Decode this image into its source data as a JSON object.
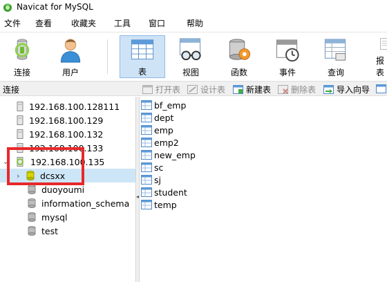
{
  "window": {
    "title": "Navicat for MySQL"
  },
  "menu": [
    "文件",
    "查看",
    "收藏夹",
    "工具",
    "窗口",
    "帮助"
  ],
  "toolbar": {
    "buttons": [
      {
        "label": "连接",
        "icon": "plug-connection-icon"
      },
      {
        "label": "用户",
        "icon": "user-icon"
      },
      {
        "label": "表",
        "icon": "table-icon",
        "active": true
      },
      {
        "label": "视图",
        "icon": "view-glasses-icon"
      },
      {
        "label": "函数",
        "icon": "function-gear-icon"
      },
      {
        "label": "事件",
        "icon": "event-clock-icon"
      },
      {
        "label": "查询",
        "icon": "query-table-icon"
      },
      {
        "label": "报表",
        "icon": "report-icon"
      }
    ]
  },
  "subbar": {
    "connection_label": "连接",
    "actions": [
      {
        "label": "打开表",
        "enabled": false
      },
      {
        "label": "设计表",
        "enabled": false
      },
      {
        "label": "新建表",
        "enabled": true
      },
      {
        "label": "删除表",
        "enabled": false
      },
      {
        "label": "导入向导",
        "enabled": true
      }
    ]
  },
  "connections": [
    {
      "label": "192.168.100.128111"
    },
    {
      "label": "192.168.100.129"
    },
    {
      "label": "192.168.100.132"
    },
    {
      "label": "192.168.100.133"
    },
    {
      "label": "192.168.100.135",
      "expanded": true
    }
  ],
  "databases": [
    {
      "label": "dcsxx",
      "selected": true
    },
    {
      "label": "duoyoumi"
    },
    {
      "label": "information_schema"
    },
    {
      "label": "mysql"
    },
    {
      "label": "test"
    }
  ],
  "tables": [
    "bf_emp",
    "dept",
    "emp",
    "emp2",
    "new_emp",
    "sc",
    "sj",
    "student",
    "temp"
  ],
  "colors": {
    "accent_selected": "#cde6f7",
    "highlight_box": "#e8282a"
  }
}
